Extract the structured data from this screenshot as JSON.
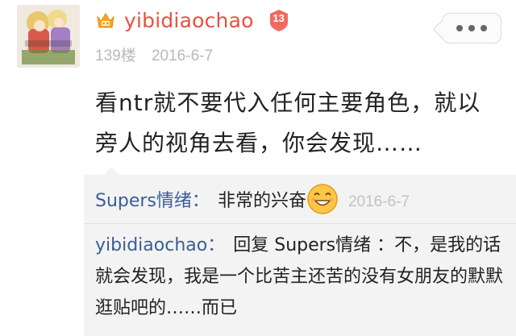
{
  "post": {
    "username": "yibidiaochao",
    "level": "13",
    "floor": "139楼",
    "date": "2016-6-7",
    "content": "看ntr就不要代入任何主要角色，就以旁人的视角去看，你会发现……"
  },
  "replies": [
    {
      "user": "Supers情绪",
      "separator": "：",
      "text": "非常的兴奋",
      "emoji": "smiley-emoji",
      "date": "2016-6-7"
    },
    {
      "user": "yibidiaochao",
      "separator": "：",
      "text": "回复 Supers情绪 ：不，是我的话就会发现，我是一个比苦主还苦的没有女朋友的默默逛贴吧的……而已"
    }
  ],
  "icons": {
    "crown": "crown-icon",
    "more": "more-options-icon"
  },
  "colors": {
    "username": "#e9503e",
    "reply_user": "#3a5d94",
    "badge": "#f06a5f",
    "meta": "#b9b9b9"
  }
}
